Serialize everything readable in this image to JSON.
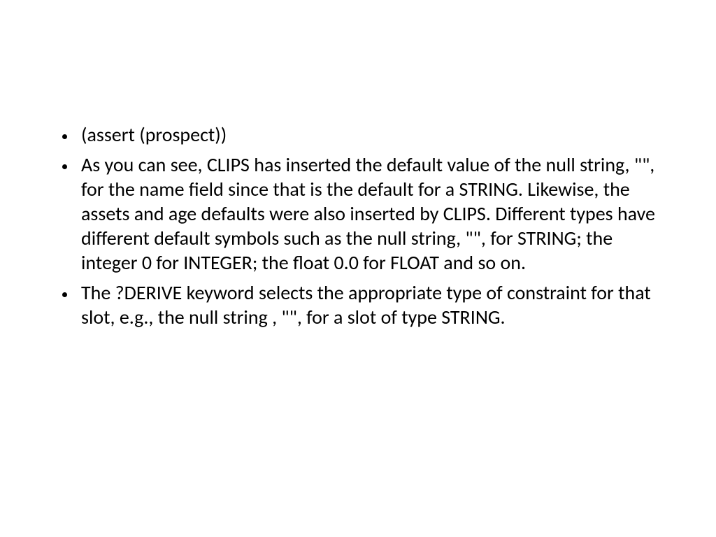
{
  "slide": {
    "bullets": [
      "(assert (prospect))",
      "As you can see, CLIPS has inserted the default value of the null string, \"\", for the name field since that is the default for a STRING. Likewise, the assets and age defaults were also inserted by CLIPS. Different types have different default symbols such as the null string, \"\", for STRING; the integer 0 for INTEGER; the float 0.0 for FLOAT and so on.",
      "The ?DERIVE keyword selects the appropriate type of constraint for that slot, e.g., the null string , \"\", for a slot of type STRING."
    ]
  }
}
